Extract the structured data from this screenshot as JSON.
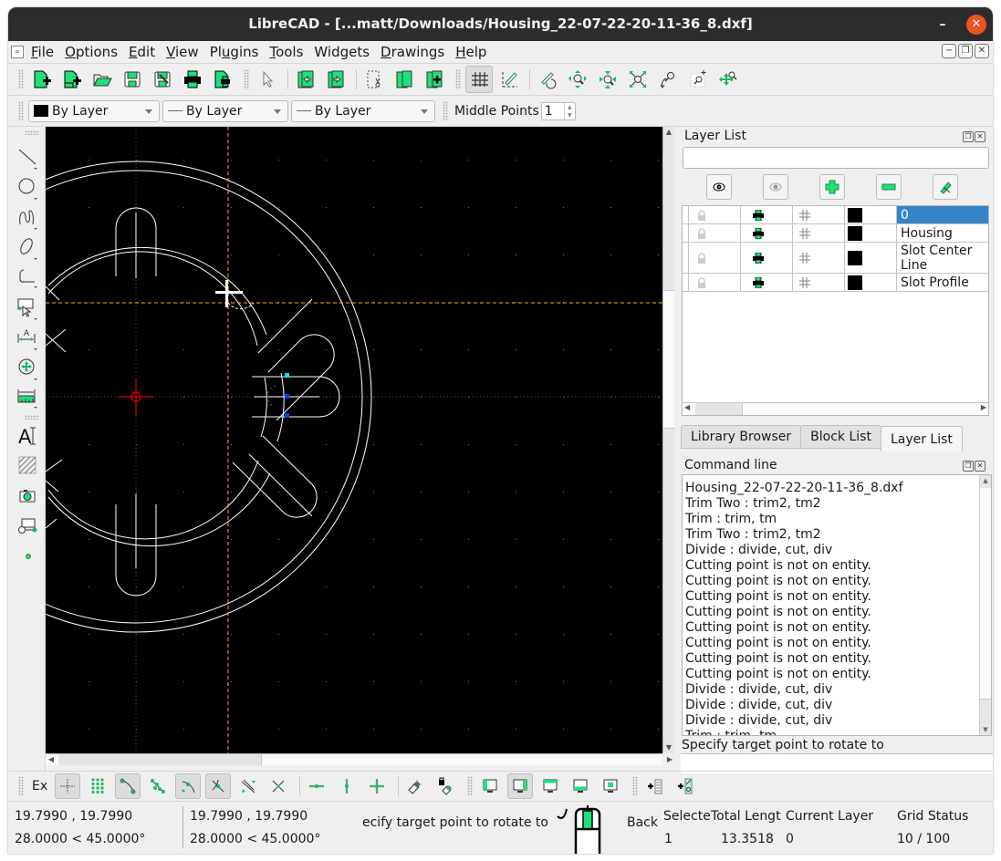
{
  "window": {
    "title": "LibreCAD - [...matt/Downloads/Housing_22-07-22-20-11-36_8.dxf]",
    "minimize_label": "–",
    "maximize_label": "□",
    "close_label": "✕"
  },
  "menubar": {
    "items": [
      {
        "label": "File",
        "mnemonic": "F",
        "rest": "ile"
      },
      {
        "label": "Options",
        "mnemonic": "O",
        "rest": "ptions"
      },
      {
        "label": "Edit",
        "mnemonic": "E",
        "rest": "dit"
      },
      {
        "label": "View",
        "mnemonic": "V",
        "rest": "iew"
      },
      {
        "label": "Plugins",
        "pre": "Pl",
        "mnemonic": "u",
        "rest": "gins"
      },
      {
        "label": "Tools",
        "mnemonic": "T",
        "rest": "ools"
      },
      {
        "label": "Widgets",
        "plain": "Widgets"
      },
      {
        "label": "Drawings",
        "mnemonic": "D",
        "rest": "rawings"
      },
      {
        "label": "Help",
        "mnemonic": "H",
        "rest": "elp"
      }
    ]
  },
  "toolbar_main": {
    "buttons": [
      "new",
      "new-from-template",
      "open",
      "save",
      "save-as",
      "print",
      "print-preview",
      "select-pointer",
      "undo",
      "redo",
      "cut",
      "copy",
      "paste",
      "grid",
      "draft",
      "redraw",
      "zoom-in",
      "zoom-out",
      "zoom-auto",
      "zoom-previous",
      "zoom-window",
      "zoom-pan"
    ],
    "active": [
      "grid"
    ]
  },
  "pen_toolbar": {
    "color": "By Layer",
    "linetype": "By Layer",
    "linewidth": "By Layer",
    "middle_points_label": "Middle Points",
    "middle_points_value": "1"
  },
  "left_toolbar": {
    "tools": [
      "line",
      "circle",
      "spline",
      "ellipse",
      "polyline",
      "select",
      "dimension",
      "modify",
      "info",
      "text",
      "hatch",
      "image",
      "block",
      "point"
    ]
  },
  "layer_list": {
    "title": "Layer List",
    "filter_placeholder": "",
    "tool_buttons": [
      "show-all-layers",
      "hide-all-layers",
      "add-layer",
      "remove-layer",
      "edit-layer"
    ],
    "layers": [
      {
        "name": "0",
        "selected": true
      },
      {
        "name": "Housing",
        "selected": false
      },
      {
        "name": "Slot Center Line",
        "selected": false
      },
      {
        "name": "Slot Profile",
        "selected": false
      }
    ]
  },
  "dock_tabs": [
    {
      "label": "Library Browser",
      "active": false
    },
    {
      "label": "Block List",
      "active": false
    },
    {
      "label": "Layer List",
      "active": true
    }
  ],
  "command_line": {
    "title": "Command line",
    "lines": [
      "Housing_22-07-22-20-11-36_8.dxf",
      "Trim Two : trim2, tm2",
      "Trim : trim, tm",
      "Trim Two : trim2, tm2",
      "Divide : divide, cut, div",
      "Cutting point is not on entity.",
      "Cutting point is not on entity.",
      "Cutting point is not on entity.",
      "Cutting point is not on entity.",
      "Cutting point is not on entity.",
      "Cutting point is not on entity.",
      "Cutting point is not on entity.",
      "Cutting point is not on entity.",
      "Divide : divide, cut, div",
      "Divide : divide, cut, div",
      "Divide : divide, cut, div",
      "Trim : trim, tm"
    ],
    "prompt": "Specify target point to rotate to",
    "input_value": ""
  },
  "snap_toolbar": {
    "exclusive_label": "Ex",
    "buttons": [
      "snap-free",
      "snap-grid",
      "snap-endpoints",
      "snap-on-entity",
      "snap-center",
      "snap-middle",
      "snap-distance",
      "snap-intersection",
      "restrict-horizontal",
      "restrict-vertical",
      "restrict-orthogonal",
      "relative-zero",
      "lock-relative-zero",
      "view-left",
      "view-active-right",
      "view-top",
      "view-bottom",
      "view-center",
      "add-block-list",
      "add-line-list"
    ],
    "active": [
      "snap-free",
      "snap-endpoints",
      "snap-center",
      "snap-middle",
      "view-active-right"
    ]
  },
  "status_bar": {
    "abs_coord": "19.7990 , 19.7990",
    "abs_polar": "28.0000 < 45.0000°",
    "rel_coord": "19.7990 , 19.7990",
    "rel_polar": "28.0000 < 45.0000°",
    "mouse_hint": "ecify target point to rotate to",
    "mouse_right": "Back",
    "selected_label": "Selecte",
    "selected_value": "1",
    "total_length_label": "Total Lengt",
    "total_length_value": "13.3518",
    "current_layer_label": "Current Layer",
    "current_layer_value": "0",
    "grid_status_label": "Grid Status",
    "grid_status_value": "10 / 100"
  },
  "colors": {
    "accent_green": "#00e676",
    "selection_blue": "#3584c8",
    "canvas_bg": "#000000",
    "crosshair_orange": "#ffb020",
    "origin_red": "#ff0000",
    "close_button": "#e95420"
  }
}
